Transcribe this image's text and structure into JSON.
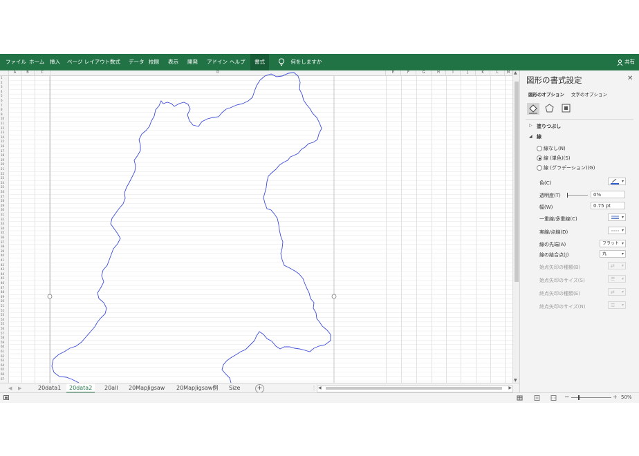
{
  "ribbon": {
    "tabs": [
      "ファイル",
      "ホーム",
      "挿入",
      "ページ レイアウト",
      "数式",
      "データ",
      "校閲",
      "表示",
      "開発",
      "アドイン",
      "ヘルプ"
    ],
    "active_tab": "書式",
    "tell_me": "何をしますか",
    "share": "共有",
    "color": "#217346"
  },
  "sheet": {
    "columns": [
      "A",
      "B",
      "C",
      "D",
      "E",
      "F",
      "G",
      "H",
      "I",
      "J",
      "K",
      "L",
      "M"
    ],
    "rows": [
      "1",
      "2",
      "3",
      "4",
      "5",
      "6",
      "7",
      "8",
      "9",
      "10",
      "11",
      "12",
      "13",
      "14",
      "15",
      "16",
      "17",
      "18",
      "19",
      "20",
      "21",
      "22",
      "23",
      "24",
      "25",
      "26",
      "27",
      "28",
      "29",
      "30",
      "31",
      "32",
      "33",
      "34",
      "35",
      "36",
      "37",
      "38",
      "39",
      "40",
      "41",
      "42",
      "43",
      "44",
      "45",
      "46",
      "47",
      "48",
      "49",
      "50",
      "51",
      "52",
      "53",
      "54",
      "55",
      "56",
      "57",
      "58",
      "59",
      "60",
      "61",
      "62",
      "63",
      "64",
      "65",
      "66",
      "67"
    ],
    "shape_outline_color": "#3b4bd8"
  },
  "sheet_tabs": {
    "tabs": [
      "20data1",
      "20data2",
      "20all",
      "20MapJigsaw",
      "20MapJigsaw例",
      "Size"
    ],
    "active_index": 1
  },
  "status": {
    "zoom": "50%",
    "zoom_minus": "−",
    "zoom_plus": "+"
  },
  "format_pane": {
    "title": "図形の書式設定",
    "close": "✕",
    "tab_shape": "図形のオプション",
    "tab_text": "文字のオプション",
    "section_fill": "塗りつぶし",
    "section_line": "線",
    "radio_none": "線なし(N)",
    "radio_solid": "線 (単色)(S)",
    "radio_gradient": "線 (グラデーション)(G)",
    "color_label": "色(C)",
    "transparency_label": "透明度(T)",
    "transparency_value": "0%",
    "width_label": "幅(W)",
    "width_value": "0.75 pt",
    "compound_label": "一重線/多重線(C)",
    "dash_label": "実線/点線(D)",
    "cap_label": "線の先端(A)",
    "cap_value": "フラット",
    "join_label": "線の結合点(J)",
    "join_value": "丸",
    "begin_arrow_type": "始点矢印の種類(B)",
    "begin_arrow_size": "始点矢印のサイズ(S)",
    "end_arrow_type": "終点矢印の種類(E)",
    "end_arrow_size": "終点矢印のサイズ(N)",
    "line_color": "#2f5fd0"
  }
}
